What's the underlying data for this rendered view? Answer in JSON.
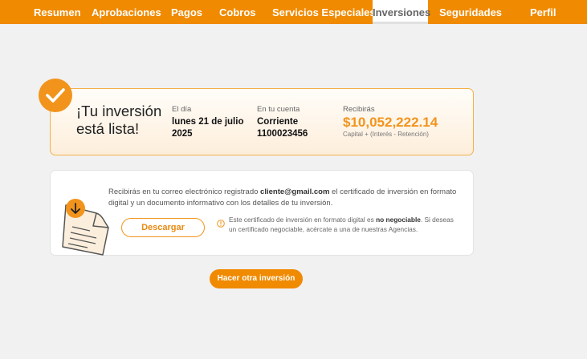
{
  "nav": {
    "items": [
      {
        "label": "Resumen",
        "active": false
      },
      {
        "label": "Aprobaciones",
        "active": false
      },
      {
        "label": "Pagos",
        "active": false
      },
      {
        "label": "Cobros",
        "active": false
      },
      {
        "label": "Servicios Especiales",
        "active": false
      },
      {
        "label": "Inversiones",
        "active": true
      },
      {
        "label": "Seguridades",
        "active": false
      },
      {
        "label": "Perfil",
        "active": false
      }
    ]
  },
  "success": {
    "title": "¡Tu inversión está lista!",
    "date_label": "El día",
    "date_value": "lunes 21 de julio 2025",
    "account_label": "En tu cuenta",
    "account_type": "Corriente",
    "account_number": "1100023456",
    "receive_label": "Recibirás",
    "receive_amount": "$10,052,222.14",
    "receive_note": "Capital + (Interés - Retención)"
  },
  "certificate": {
    "text_before": "Recibirás en tu correo electrónico registrado ",
    "email": "cliente@gmail.com",
    "text_after": " el certificado de inversión en formato digital y un documento informativo con los detalles de tu inversión.",
    "download_label": "Descargar",
    "note_before": "Este certificado de inversión en formato digital es ",
    "note_bold": "no negociable",
    "note_after": ". Si deseas un certificado negociable, acércate a una de nuestras Agencias."
  },
  "cta": {
    "label": "Hacer otra inversión"
  },
  "colors": {
    "brand_orange": "#f08a00",
    "accent_orange": "#f2941c",
    "page_background": "#f1f1f1"
  },
  "icons": [
    "check-icon",
    "document-download-icon",
    "info-icon"
  ]
}
